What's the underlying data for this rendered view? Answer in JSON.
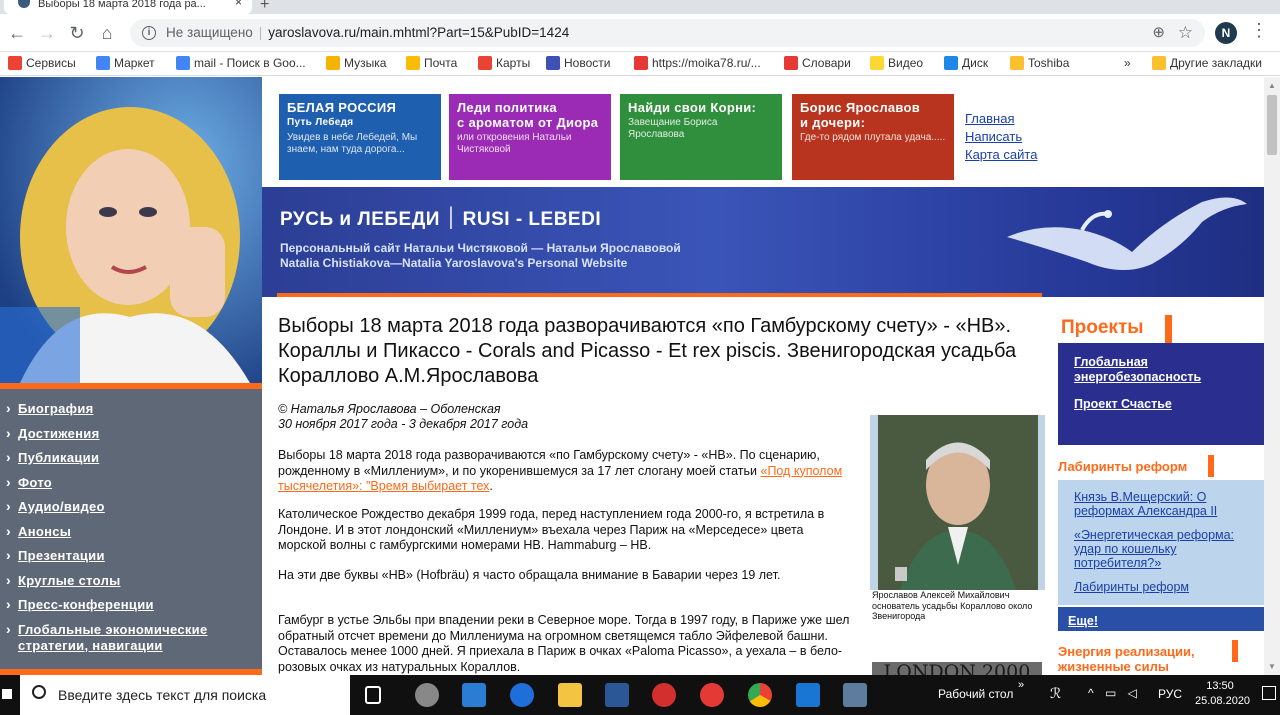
{
  "browser": {
    "tab_title": "Выборы 18 марта 2018 года ра...",
    "tab_close": "×",
    "new_tab": "+",
    "url_security": "Не защищено",
    "url": "yaroslavova.ru/main.mhtml?Part=15&PubID=1424",
    "profile_initial": "N",
    "bookmarks": [
      {
        "label": "Сервисы",
        "color": "#ea4335"
      },
      {
        "label": "Маркет",
        "color": "#4285f4"
      },
      {
        "label": "mail - Поиск в Goo...",
        "color": "#4285f4"
      },
      {
        "label": "Музыка",
        "color": "#f4b400"
      },
      {
        "label": "Почта",
        "color": "#fbbc05"
      },
      {
        "label": "Карты",
        "color": "#ea4335"
      },
      {
        "label": "Новости",
        "color": "#3f51b5"
      },
      {
        "label": "https://moika78.ru/...",
        "color": "#e53935"
      },
      {
        "label": "Словари",
        "color": "#e53935"
      },
      {
        "label": "Видео",
        "color": "#fdd835"
      },
      {
        "label": "Диск",
        "color": "#1e88e5"
      },
      {
        "label": "Toshiba",
        "color": "#fbc02d"
      }
    ],
    "bookmarks_more": "»",
    "other_bookmarks": "Другие закладки"
  },
  "top_boxes": [
    {
      "title": "БЕЛАЯ РОССИЯ",
      "title2": "Путь Лебедя",
      "subtitle": "Увидев в небе Лебедей, Мы знаем, нам туда дорога...",
      "color": "#1e5fb0"
    },
    {
      "title": "Леди политика",
      "title2": "с ароматом от Диора",
      "subtitle": "или откровения Натальи Чистяковой",
      "color": "#9b2ab5"
    },
    {
      "title": "Найди свои Корни:",
      "title2": "",
      "subtitle": "Завещание Бориса Ярославова",
      "color": "#2f8f3c"
    },
    {
      "title": "Борис Ярославов",
      "title2": "и дочери:",
      "subtitle": "Где-то рядом плутала удача.....",
      "color": "#b8341e"
    }
  ],
  "top_links": [
    "Главная",
    "Написать",
    "Карта сайта"
  ],
  "banner": {
    "title": "РУСЬ и ЛЕБЕДИ ׀ RUSI - LEBEDI",
    "sub1": "Персональный сайт Натальи Чистяковой — Натальи Ярославовой",
    "sub2": "Natalia Chistiakova—Natalia Yaroslavova's  Personal Website"
  },
  "left_nav": [
    "Биография",
    "Достижения",
    "Публикации",
    "Фото",
    "Аудио/видео",
    "Анонсы",
    "Презентации",
    "Круглые столы",
    "Пресс-конференции",
    "Глобальные экономические стратегии, навигации"
  ],
  "article": {
    "title": "Выборы 18 марта 2018 года разворачиваются «по Гамбурскому счету» - «НВ». Кораллы и Пикассо - Corals and Picasso - Et rex piscis. Звенигородская усадьба Кораллово А.М.Ярославова",
    "author": "© Наталья Ярославова – Оболенская",
    "dates": "30 ноября 2017 года - 3 декабря 2017 года",
    "p1_text": "Выборы 18 марта 2018 года разворачиваются «по Гамбурскому счету» - «НВ». По сценарию, рожденному в «Миллениум», и по укоренившемуся за 17 лет слогану моей статьи ",
    "p1_link": "«Под куполом тысячелетия»: \"Время выбирает тех",
    "p1_end": ".",
    "p2": "Католическое Рождество декабря 1999 года, перед наступлением года 2000-го, я встретила в Лондоне. И в этот лондонский «Миллениум» въехала через Париж на «Мерседесе» цвета морской волны с гамбургскими номерами НВ. Hammaburg – НВ.",
    "p3": "На эти две буквы «НВ» (Hofbräu) я часто обращала внимание в Баварии через 19 лет.",
    "p4": "Гамбург в устье Эльбы при впадении реки в Северное море. Тогда в 1997 году, в Париже уже шел обратный отсчет времени до Миллениума на огромном светящемся табло Эйфелевой башни. Оставалось менее 1000 дней. Я приехала в Париж в очках «Paloma Picasso», а уехала – в бело-розовых очках из натуральных Кораллов.",
    "portrait_caption": "Ярославов Алексей Михайлович основатель усадьбы Кораллово около Звенигорода",
    "london_text": "LONDON 2000"
  },
  "sidebar": {
    "projects_title": "Проекты",
    "projects": [
      "Глобальная энергобезопасность",
      "Проект Счастье"
    ],
    "labyrinth_title": "Лабиринты реформ",
    "labyrinth_links": [
      "Князь В.Мещерский: О реформах Александра II",
      "«Энергетическая реформа: удар по кошельку потребителя?»",
      "Лабиринты реформ"
    ],
    "eshe": "Еще!",
    "energy_title": "Энергия реализации, жизненные силы"
  },
  "taskbar": {
    "search_placeholder": "Введите здесь текст для поиска",
    "desktop_label": "Рабочий стол",
    "chevron": "»",
    "lang": "РУС",
    "time": "13:50",
    "date": "25.08.2020"
  },
  "colors": {
    "accent_orange": "#ff6a1a",
    "nav_grey": "#5f6876",
    "banner_blue": "#2c3e95",
    "project_navy": "#2a2e8f",
    "light_blue": "#bcd5ec"
  }
}
